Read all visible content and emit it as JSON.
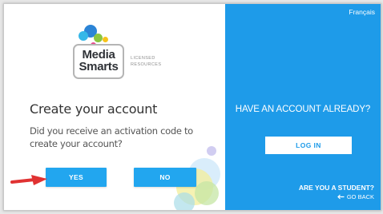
{
  "logo": {
    "brand_line1": "Media",
    "brand_line2": "Smarts",
    "sub_line1": "LICENSED",
    "sub_line2": "RESOURCES"
  },
  "main": {
    "title": "Create your account",
    "question": "Did you receive an activation code to create your account?",
    "yes_label": "YES",
    "no_label": "NO"
  },
  "side": {
    "language_link": "Français",
    "have_account": "HAVE AN ACCOUNT ALREADY?",
    "login_label": "LOG IN",
    "student_question": "ARE YOU A STUDENT?",
    "go_back": "GO BACK",
    "go_back_icon": "arrow-left-icon"
  },
  "colors": {
    "panel_blue": "#1e9be9",
    "button_blue": "#22a6ef",
    "annotation_arrow": "#e03232"
  }
}
